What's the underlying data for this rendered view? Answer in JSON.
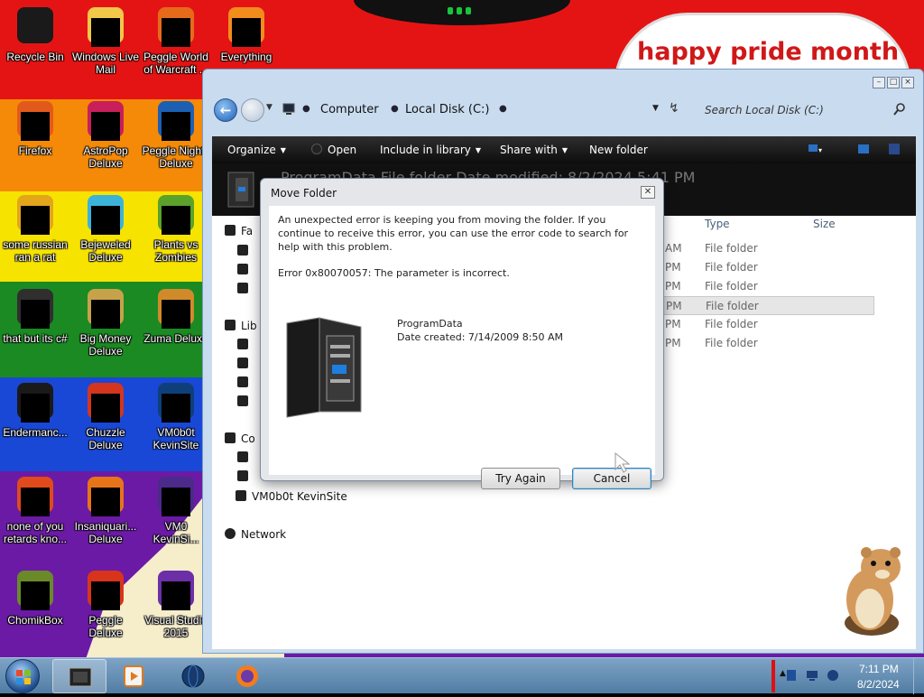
{
  "desktop": {
    "banner": "happy pride month",
    "icons": [
      {
        "label": "Recycle Bin",
        "color": "#1a1a1a"
      },
      {
        "label": "Windows Live Mail",
        "color": "#f1c84a"
      },
      {
        "label": "Peggle World of Warcraft ...",
        "color": "#e56b1a"
      },
      {
        "label": "Everything",
        "color": "#f28c1c"
      },
      {
        "label": "Firefox",
        "color": "#e25a1b"
      },
      {
        "label": "AstroPop Deluxe",
        "color": "#c81f5a"
      },
      {
        "label": "Peggle Nights Deluxe",
        "color": "#1c5fb3"
      },
      {
        "label": "some russian ran a rat",
        "color": "#e3a51a"
      },
      {
        "label": "Bejeweled Deluxe",
        "color": "#3bb3d8"
      },
      {
        "label": "Plants vs Zombies",
        "color": "#5aa22a"
      },
      {
        "label": "that but its c#",
        "color": "#2f2f2f"
      },
      {
        "label": "Big Money Deluxe",
        "color": "#c6a24a"
      },
      {
        "label": "Zuma Deluxe",
        "color": "#d18a2a"
      },
      {
        "label": "Endermanc...",
        "color": "#1a1a1a"
      },
      {
        "label": "Chuzzle Deluxe",
        "color": "#d3351e"
      },
      {
        "label": "VM0b0t KevinSite",
        "color": "#0f3f7a"
      },
      {
        "label": "none of you retards kno...",
        "color": "#e04a1c"
      },
      {
        "label": "Insaniquari... Deluxe",
        "color": "#e8741a"
      },
      {
        "label": "VM0 KevinSi...",
        "color": "#4b2a8a"
      },
      {
        "label": "ChomikBox",
        "color": "#6a8a2a"
      },
      {
        "label": "Peggle Deluxe",
        "color": "#d8341c"
      },
      {
        "label": "Visual Studio 2015",
        "color": "#6c2fa8"
      }
    ]
  },
  "explorer": {
    "breadcrumb": [
      "Computer",
      "Local Disk (C:)"
    ],
    "search_placeholder": "Search Local Disk (C:)",
    "commands": {
      "organize": "Organize",
      "open": "Open",
      "include": "Include in library",
      "share": "Share with",
      "new_folder": "New folder"
    },
    "details_title": "ProgramData   File folder   Date modified: 8/2/2024 5:41 PM",
    "nav": {
      "favorites": "Fa",
      "libraries": "Lib",
      "computer": "Co",
      "kevinsite": "VM0b0t KevinSite",
      "network": "Network"
    },
    "columns": {
      "type": "Type",
      "size": "Size"
    },
    "rows": [
      {
        "time": "AM",
        "type": "File folder"
      },
      {
        "time": "PM",
        "type": "File folder"
      },
      {
        "time": "PM",
        "type": "File folder"
      },
      {
        "time": "PM",
        "type": "File folder"
      },
      {
        "time": "PM",
        "type": "File folder"
      },
      {
        "time": "PM",
        "type": "File folder"
      }
    ]
  },
  "dialog": {
    "title": "Move Folder",
    "message": "An unexpected error is keeping you from moving the folder. If you continue to receive this error, you can use the error code to search for help with this problem.",
    "error": "Error 0x80070057: The parameter is incorrect.",
    "item_name": "ProgramData",
    "item_date": "Date created: 7/14/2009 8:50 AM",
    "try_again": "Try Again",
    "cancel": "Cancel"
  },
  "taskbar": {
    "apps": [
      "explorer",
      "media-player",
      "network-app",
      "firefox"
    ],
    "time": "7:11 PM",
    "date": "8/2/2024"
  }
}
